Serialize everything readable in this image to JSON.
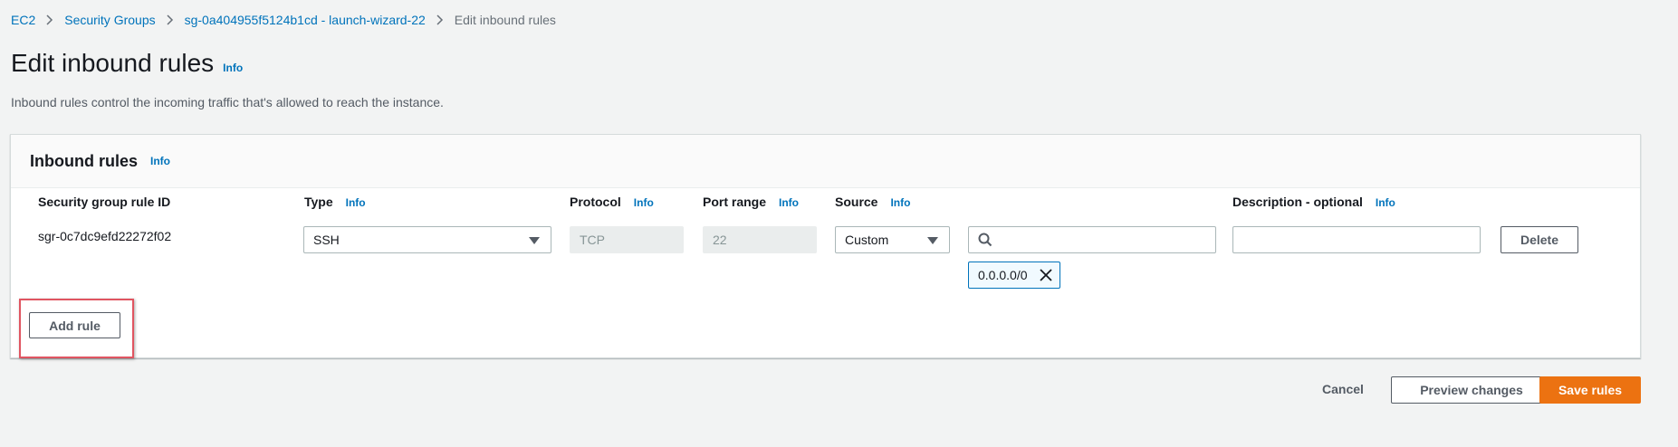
{
  "breadcrumb": {
    "items": [
      "EC2",
      "Security Groups",
      "sg-0a404955f5124b1cd - launch-wizard-22"
    ],
    "current": "Edit inbound rules"
  },
  "page": {
    "title": "Edit inbound rules",
    "info": "Info",
    "description": "Inbound rules control the incoming traffic that's allowed to reach the instance."
  },
  "panel": {
    "title": "Inbound rules",
    "info": "Info",
    "columns": {
      "rule_id": "Security group rule ID",
      "type": "Type",
      "protocol": "Protocol",
      "port_range": "Port range",
      "source": "Source",
      "description": "Description - optional"
    },
    "info_label": "Info",
    "rule": {
      "id": "sgr-0c7dc9efd22272f02",
      "type": "SSH",
      "protocol": "TCP",
      "port_range": "22",
      "source": "Custom",
      "source_search": "",
      "source_token": "0.0.0.0/0",
      "description": "",
      "delete_label": "Delete"
    },
    "add_rule_label": "Add rule"
  },
  "footer": {
    "cancel_label": "Cancel",
    "preview_label": "Preview changes",
    "save_label": "Save rules"
  },
  "colors": {
    "link": "#0073bb",
    "primary": "#ec7211",
    "highlight": "#e05561"
  }
}
